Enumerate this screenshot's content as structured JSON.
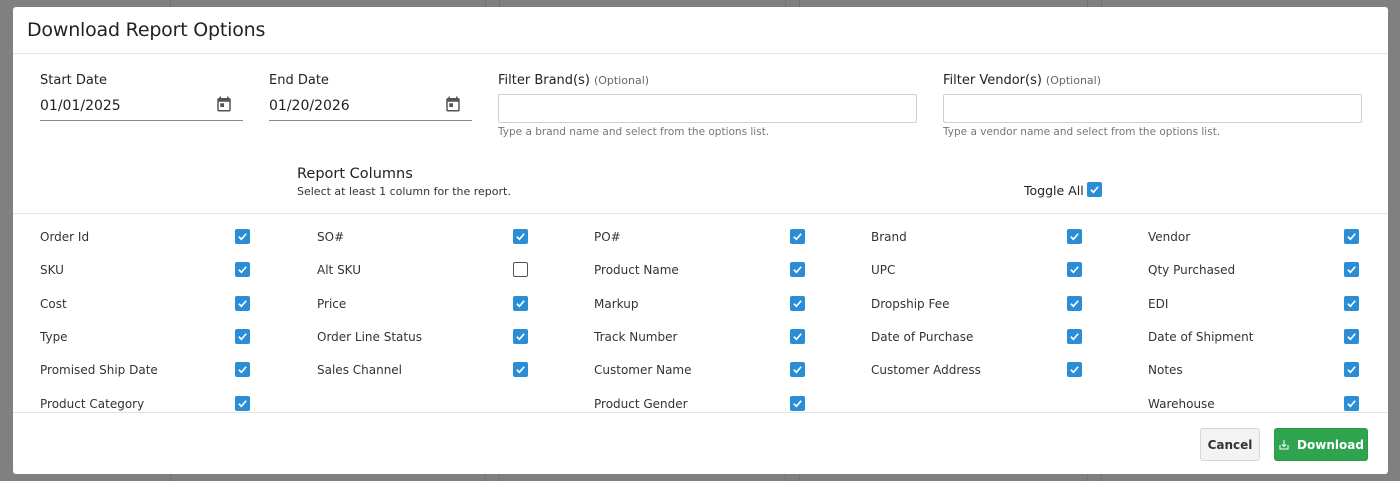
{
  "dialog": {
    "title": "Download Report Options"
  },
  "filters": {
    "start_date_label": "Start Date",
    "start_date_value": "01/01/2025",
    "end_date_label": "End Date",
    "end_date_value": "01/20/2026",
    "brand_label": "Filter Brand(s)",
    "brand_optional": "(Optional)",
    "brand_hint": "Type a brand name and select from the options list.",
    "vendor_label": "Filter Vendor(s)",
    "vendor_optional": "(Optional)",
    "vendor_hint": "Type a vendor name and select from the options list."
  },
  "report_columns": {
    "title": "Report Columns",
    "subtitle": "Select at least 1 column for the report.",
    "toggle_all_label": "Toggle All",
    "toggle_all_checked": true,
    "columns": [
      [
        {
          "label": "Order Id",
          "checked": true
        },
        {
          "label": "SKU",
          "checked": true
        },
        {
          "label": "Cost",
          "checked": true
        },
        {
          "label": "Type",
          "checked": true
        },
        {
          "label": "Promised Ship Date",
          "checked": true
        },
        {
          "label": "Product Category",
          "checked": true
        }
      ],
      [
        {
          "label": "SO#",
          "checked": true
        },
        {
          "label": "Alt SKU",
          "checked": false
        },
        {
          "label": "Price",
          "checked": true
        },
        {
          "label": "Order Line Status",
          "checked": true
        },
        {
          "label": "Sales Channel",
          "checked": true
        }
      ],
      [
        {
          "label": "PO#",
          "checked": true
        },
        {
          "label": "Product Name",
          "checked": true
        },
        {
          "label": "Markup",
          "checked": true
        },
        {
          "label": "Track Number",
          "checked": true
        },
        {
          "label": "Customer Name",
          "checked": true
        },
        {
          "label": "Product Gender",
          "checked": true
        }
      ],
      [
        {
          "label": "Brand",
          "checked": true
        },
        {
          "label": "UPC",
          "checked": true
        },
        {
          "label": "Dropship Fee",
          "checked": true
        },
        {
          "label": "Date of Purchase",
          "checked": true
        },
        {
          "label": "Customer Address",
          "checked": true
        }
      ],
      [
        {
          "label": "Vendor",
          "checked": true
        },
        {
          "label": "Qty Purchased",
          "checked": true
        },
        {
          "label": "EDI",
          "checked": true
        },
        {
          "label": "Date of Shipment",
          "checked": true
        },
        {
          "label": "Notes",
          "checked": true
        },
        {
          "label": "Warehouse",
          "checked": true
        }
      ]
    ]
  },
  "footer": {
    "cancel_label": "Cancel",
    "download_label": "Download"
  },
  "colors": {
    "checkbox_accent": "#2b8dd6",
    "download_button": "#2ea44f"
  },
  "icons": {
    "date_picker": "calendar-icon",
    "download": "download-icon",
    "checked": "checkmark-icon"
  }
}
